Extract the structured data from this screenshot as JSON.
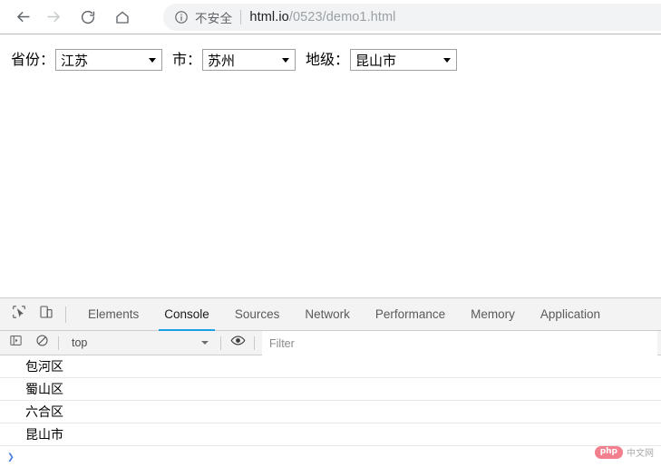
{
  "browser": {
    "nav": {
      "back_icon": "arrow-left-icon",
      "forward_icon": "arrow-right-icon",
      "reload_icon": "reload-icon",
      "home_icon": "home-icon"
    },
    "omnibox": {
      "security_icon": "info-circle-icon",
      "security_label": "不安全",
      "url_host": "html.io",
      "url_path": "/0523/demo1.html"
    }
  },
  "page": {
    "fields": [
      {
        "label": "省份：",
        "name": "province",
        "value": "江苏",
        "caret_icon": "chevron-down-icon"
      },
      {
        "label": "市：",
        "name": "city",
        "value": "苏州",
        "caret_icon": "chevron-down-icon"
      },
      {
        "label": "地级：",
        "name": "district",
        "value": "昆山市",
        "caret_icon": "chevron-down-icon"
      }
    ]
  },
  "devtools": {
    "inspect_icon": "inspect-element-icon",
    "device_toolbar_icon": "device-toolbar-icon",
    "tabs": [
      {
        "label": "Elements",
        "active": false
      },
      {
        "label": "Console",
        "active": true
      },
      {
        "label": "Sources",
        "active": false
      },
      {
        "label": "Network",
        "active": false
      },
      {
        "label": "Performance",
        "active": false
      },
      {
        "label": "Memory",
        "active": false
      },
      {
        "label": "Application",
        "active": false
      }
    ],
    "console_toolbar": {
      "sidebar_icon": "console-sidebar-icon",
      "clear_icon": "clear-console-icon",
      "context": "top",
      "context_caret_icon": "chevron-down-icon",
      "eye_icon": "live-expression-eye-icon",
      "filter_placeholder": "Filter",
      "filter_value": ""
    },
    "console_messages": [
      "包河区",
      "蜀山区",
      "六合区",
      "昆山市"
    ],
    "prompt_symbol": "❯"
  },
  "watermark": {
    "badge": "php",
    "text": "中文网",
    "badge_color": "#f0697a"
  }
}
